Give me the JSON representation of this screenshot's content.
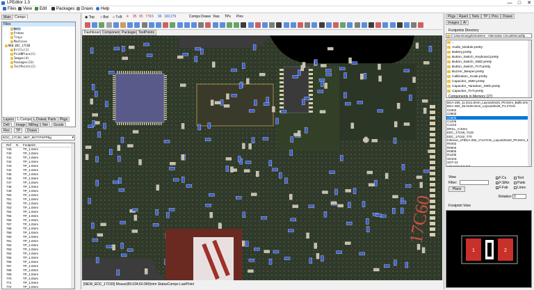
{
  "app": {
    "title": "LPEditor 1.3",
    "min": "—",
    "max": "□",
    "close": "✕"
  },
  "menu": [
    {
      "label": "Files",
      "icon": "folder-icon",
      "color": "#2b6cd4"
    },
    {
      "label": "View",
      "icon": "eye-icon",
      "color": "#555555"
    },
    {
      "label": "Edit",
      "icon": "pencil-icon",
      "color": "#3a8a3a"
    },
    {
      "label": "Packages",
      "icon": "package-icon",
      "color": "#333333"
    },
    {
      "label": "Draws",
      "icon": "draw-icon",
      "color": "#888888"
    },
    {
      "label": "Help",
      "icon": "help-icon",
      "color": "#2b6cd4"
    }
  ],
  "toolbar": {
    "top_label": "Top",
    "bot_label": "Bot",
    "tb_label": "T+B",
    "numbers": [
      "4",
      "95",
      "95",
      "779",
      "6",
      "96",
      "160",
      "279"
    ],
    "tabs": [
      "Comps",
      "Draws",
      "Vias",
      "TPs",
      "Pins"
    ]
  },
  "left": {
    "top_tabs": [
      "Main",
      "Comps"
    ],
    "tree_header": "Files",
    "tree_items": [
      {
        "label": "Nets",
        "indent": 1,
        "selected": true
      },
      {
        "label": "Probes",
        "indent": 1
      },
      {
        "label": "Trays",
        "indent": 1
      },
      {
        "label": "Machines",
        "indent": 1
      },
      {
        "label": "NEW_EDC_17C60",
        "indent": 0
      },
      {
        "label": "Drills(1)",
        "indent": 1
      },
      {
        "label": "PickNPlace(1)",
        "indent": 1
      },
      {
        "label": "Images(4)",
        "indent": 1
      },
      {
        "label": "Packages(23)",
        "indent": 1
      },
      {
        "label": "TestPoints(2)",
        "indent": 1
      }
    ],
    "tabs_row1": [
      "Layers",
      "L.Comps",
      "L.Draws",
      "Parts",
      "Pkgs"
    ],
    "tabs_row2": [
      "Drill",
      "Image",
      "Milling",
      "Net",
      "Gcode"
    ],
    "tabs_row3": [
      "Rex",
      "TP",
      "Draws"
    ],
    "selector": "EDC_17C60_NET_BOT:PnPPkg",
    "list_headers": [
      "Ref",
      "N",
      "Footprint"
    ],
    "rows": [
      {
        "ref": "739",
        "fp": "TP_1.0mm"
      },
      {
        "ref": "740",
        "fp": "TP_1.0mm"
      },
      {
        "ref": "741",
        "fp": "TP_1.0mm"
      },
      {
        "ref": "742",
        "fp": "TP_1.0mm"
      },
      {
        "ref": "743",
        "fp": "TP_1.0mm"
      },
      {
        "ref": "744",
        "fp": "TP_1.0mm"
      },
      {
        "ref": "745",
        "fp": "TP_1.0mm"
      },
      {
        "ref": "746",
        "fp": "TP_1.0mm"
      },
      {
        "ref": "747",
        "fp": "TP_1.0mm"
      },
      {
        "ref": "748",
        "fp": "TP_1.0mm"
      },
      {
        "ref": "749",
        "fp": "TP_1.0mm"
      },
      {
        "ref": "750",
        "fp": "TP_1.0mm"
      },
      {
        "ref": "751",
        "fp": "TP_1.0mm"
      },
      {
        "ref": "752",
        "fp": "TP_1.0mm"
      },
      {
        "ref": "753",
        "fp": "TP_1.0mm"
      },
      {
        "ref": "754",
        "fp": "TP_1.0mm"
      },
      {
        "ref": "755",
        "fp": "TP_1.0mm"
      },
      {
        "ref": "756",
        "fp": "TP_1.0mm"
      },
      {
        "ref": "757",
        "fp": "TP_1.0mm"
      },
      {
        "ref": "758",
        "fp": "TP_1.0mm"
      },
      {
        "ref": "759",
        "fp": "TP_1.0mm"
      },
      {
        "ref": "760",
        "fp": "TP_1.0mm"
      },
      {
        "ref": "761",
        "fp": "TP_1.0mm"
      },
      {
        "ref": "762",
        "fp": "TP_1.0mm"
      },
      {
        "ref": "763",
        "fp": "TP_1.0mm"
      },
      {
        "ref": "764",
        "fp": "TP_1.0mm"
      },
      {
        "ref": "765",
        "fp": "TP_1.0mm"
      },
      {
        "ref": "766",
        "fp": "TP_1.0mm"
      },
      {
        "ref": "767",
        "fp": "TP_1.0mm"
      },
      {
        "ref": "768",
        "fp": "TP_1.0mm"
      },
      {
        "ref": "769",
        "fp": "TP_1.0mm"
      },
      {
        "ref": "770",
        "fp": "TP_1.0mm"
      },
      {
        "ref": "771",
        "fp": "TP_1.0mm"
      },
      {
        "ref": "772",
        "fp": "TP_1.0mm"
      }
    ]
  },
  "doc_tabs": [
    "Dashboard",
    "Components",
    "Packages",
    "TestPoints"
  ],
  "status": {
    "text": "[NEW_EDC_17C60] Mouse(89.034;60.969)mm StatusComps LastPoint"
  },
  "board": {
    "silkscreen_text": "17C60"
  },
  "right": {
    "tabs_row1": [
      "Pkgs",
      "Rpanl",
      "Nets",
      "TP",
      "Pins",
      "Draws"
    ],
    "tabs_row2": [
      "Images",
      "AI"
    ],
    "footprint_dir_label": "Footprints Directory",
    "path": "C:\\Users\\nvega\\OneDrive - Alternative Circuits\\Kicad\\lp...",
    "dir_items": [
      "..",
      "Audio_Module.pretty",
      "Battery.pretty",
      "Button_Switch_Keyboard.pretty",
      "Button_Switch_SMD.pretty",
      "Button_Switch_THT.pretty",
      "Buzzer_Beeper.pretty",
      "Calibration_Scale.pretty",
      "Capacitor_SMD.pretty",
      "Capacitor_Tantalum_SMD.pretty",
      "Capacitor_THT.pretty"
    ],
    "mem_label": "Components in Memory (27)",
    "mem_items": [
      "BGA-255_11.0x11.0mm_Layout20x20_P0.5mm_Ball0.3mm",
      "BGA-352_35.0x35.0mm_Layout26x26_P1.27mm",
      "C0402",
      "C0603",
      "C0805",
      "C1206",
      "C1210",
      "DRILL_0.3mm",
      "EDC_17C60_T120",
      "EDC_17C62_T70",
      "Infineon_LFBGA-292_17x17mm_Layout20x20_P0.8mm_Ball0.4mm",
      "R0402",
      "R0603",
      "R0805",
      "R1206",
      "SOIC8",
      "SOT-23",
      "STM32F100VET",
      "TSSOP-20_4.4x6.5mm_Layout17x17_P0.65mm"
    ],
    "mem_selected": 4,
    "view_label": "View",
    "filter_label": "Filter:",
    "place_label": "Place",
    "checks": [
      {
        "label": "F.Cu",
        "checked": true
      },
      {
        "label": "F.Silks",
        "checked": true
      },
      {
        "label": "F.Fab",
        "checked": true
      },
      {
        "label": "Text",
        "checked": false
      },
      {
        "label": "Pads",
        "checked": false
      },
      {
        "label": "Lines",
        "checked": false
      }
    ],
    "rotation_label": "Rotation",
    "rotation_value": "0",
    "fp_view_label": "Footprint View",
    "pad_labels": [
      "1",
      "2"
    ]
  },
  "colors": {
    "board_green": "#2f3a2b",
    "copper": "#c0a050",
    "pad_blue": "#3a5fd0",
    "selection_blue": "#0078d7"
  }
}
